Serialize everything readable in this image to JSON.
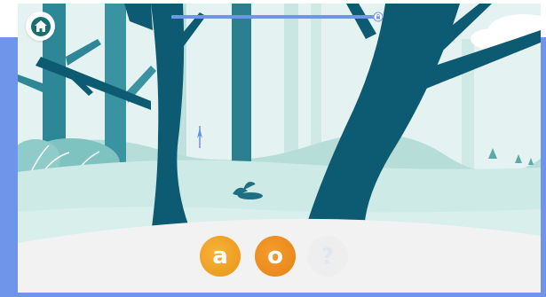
{
  "progress": {
    "fraction": 0.99,
    "end_icon": "lock-icon"
  },
  "home": {
    "icon": "home-icon"
  },
  "answer_tiles": [
    {
      "letter": "a",
      "state": "filled",
      "color": "#f0a028"
    },
    {
      "letter": "o",
      "state": "filled",
      "color": "#ec8e1e"
    },
    {
      "letter": "?",
      "state": "empty",
      "color": "#eeeeef"
    }
  ],
  "colors": {
    "accent": "#6f95ea",
    "tree_dark": "#0d5a73",
    "tree_mid": "#2b7f8f",
    "sky": "#e6f4f2",
    "ground": "#f2f2f3"
  }
}
